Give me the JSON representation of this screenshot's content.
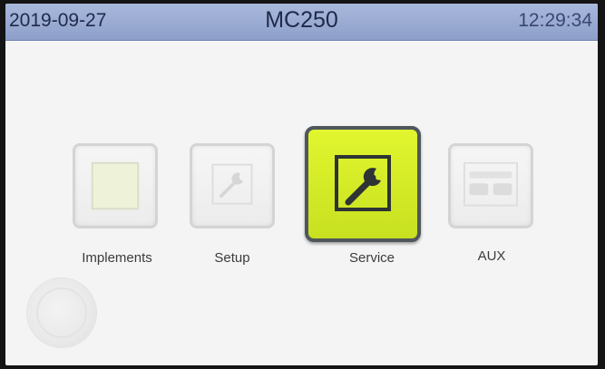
{
  "status_bar": {
    "date": "2019-09-27",
    "title": "MC250",
    "time": "12:29:34"
  },
  "menu": {
    "items": [
      {
        "label": "Implements",
        "icon": "implements-icon",
        "active": false
      },
      {
        "label": "Setup",
        "icon": "wrench-icon",
        "active": false
      },
      {
        "label": "Service",
        "icon": "wrench-icon",
        "active": true
      },
      {
        "label": "AUX",
        "icon": "aux-icon",
        "active": false
      }
    ]
  },
  "home_button": {
    "icon": "home-icon"
  },
  "colors": {
    "status_bar": "#99aad3",
    "active_tile": "#d8ef27",
    "active_border": "#4f575c",
    "screen_background": "#f4f4f4"
  }
}
